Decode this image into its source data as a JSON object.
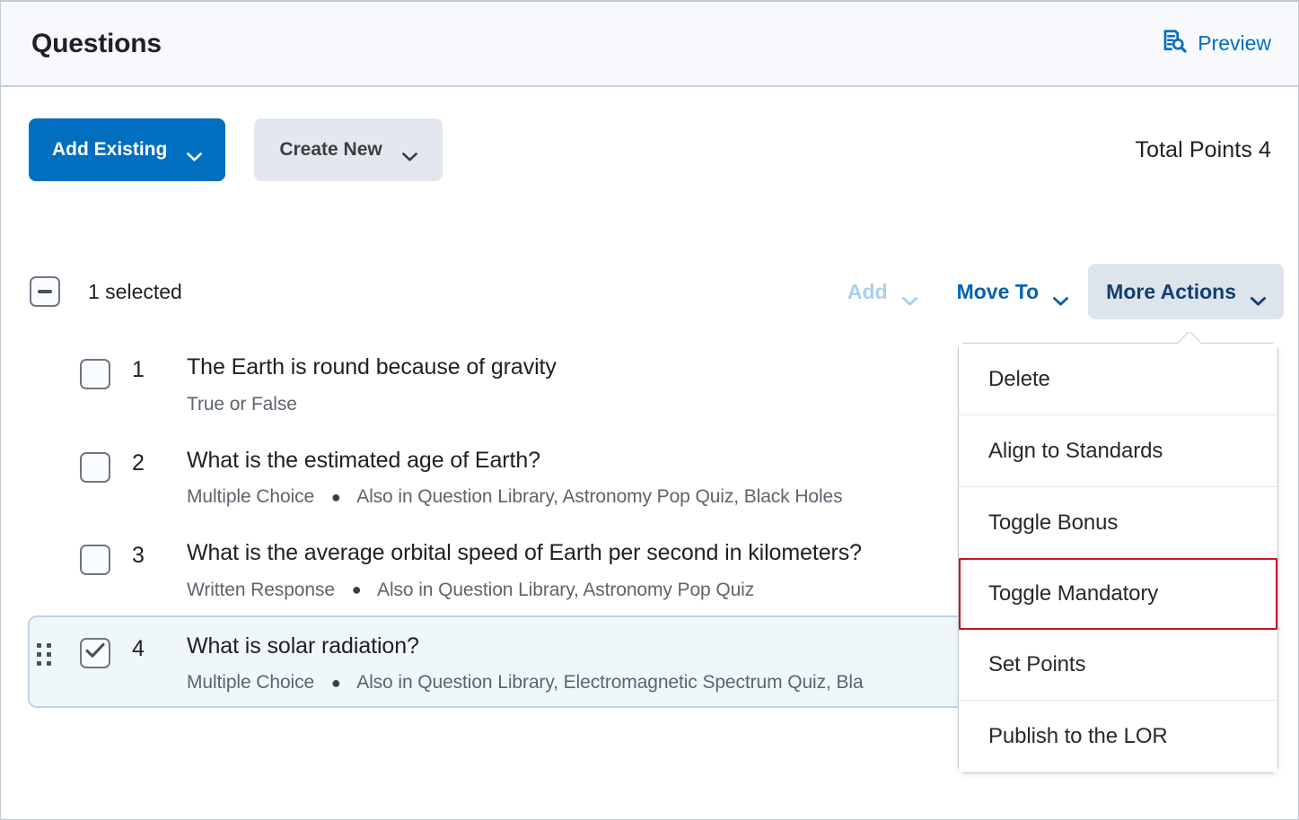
{
  "header": {
    "title": "Questions",
    "preview_label": "Preview",
    "preview_icon": "document-search-icon"
  },
  "toolbar": {
    "add_existing_label": "Add Existing",
    "create_new_label": "Create New",
    "total_points_label": "Total Points 4"
  },
  "selection_bar": {
    "selected_label": "1 selected",
    "checkbox_state": "indeterminate",
    "add_label": "Add",
    "add_disabled": true,
    "move_to_label": "Move To",
    "more_actions_label": "More Actions"
  },
  "questions": [
    {
      "index": "1",
      "title": "The Earth is round because of gravity",
      "type": "True or False",
      "also_in": "",
      "selected": false
    },
    {
      "index": "2",
      "title": "What is the estimated age of Earth?",
      "type": "Multiple Choice",
      "also_in": "Also in Question Library, Astronomy Pop Quiz, Black Holes",
      "selected": false
    },
    {
      "index": "3",
      "title": "What is the average orbital speed of Earth per second in kilometers?",
      "type": "Written Response",
      "also_in": "Also in Question Library, Astronomy Pop Quiz",
      "selected": false
    },
    {
      "index": "4",
      "title": "What is solar radiation?",
      "type": "Multiple Choice",
      "also_in": "Also in Question Library, Electromagnetic Spectrum Quiz, Bla",
      "selected": true
    }
  ],
  "more_actions_menu": {
    "items": [
      {
        "label": "Delete",
        "highlighted": false
      },
      {
        "label": "Align to Standards",
        "highlighted": false
      },
      {
        "label": "Toggle Bonus",
        "highlighted": false
      },
      {
        "label": "Toggle Mandatory",
        "highlighted": true
      },
      {
        "label": "Set Points",
        "highlighted": false
      },
      {
        "label": "Publish to the LOR",
        "highlighted": false
      }
    ]
  },
  "colors": {
    "primary_blue": "#006fbf",
    "link_blue": "#0063b2",
    "disabled_blue": "#a9cfea",
    "toggled_bg": "#dde4ec",
    "selected_row_bg": "#eff7fb",
    "selected_row_border": "#bcd5ea",
    "highlight_red": "#c3171e",
    "header_bg": "#f7f9fc",
    "secondary_btn_bg": "#e3e8ee"
  }
}
